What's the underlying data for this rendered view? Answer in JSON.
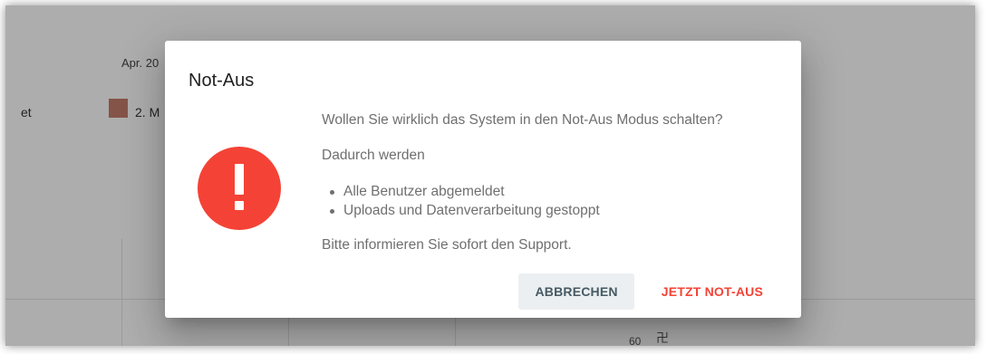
{
  "background": {
    "month_label": "Apr. 20",
    "legend_left_text": "et",
    "legend_item_text": "2. M",
    "legend_item_color": "#c57c6a",
    "axis_value": "60",
    "axis_glyph": "卍"
  },
  "dialog": {
    "title": "Not-Aus",
    "icon": "alert-exclamation-icon",
    "icon_color": "#f44336",
    "question": "Wollen Sie wirklich das System in den Not-Aus Modus schalten?",
    "intro": "Dadurch werden",
    "bullets": [
      "Alle Benutzer abgemeldet",
      "Uploads und Datenverarbeitung gestoppt"
    ],
    "support_note": "Bitte informieren Sie sofort den Support.",
    "cancel_label": "ABBRECHEN",
    "confirm_label": "JETZT NOT-AUS",
    "accent_color": "#f44336"
  }
}
